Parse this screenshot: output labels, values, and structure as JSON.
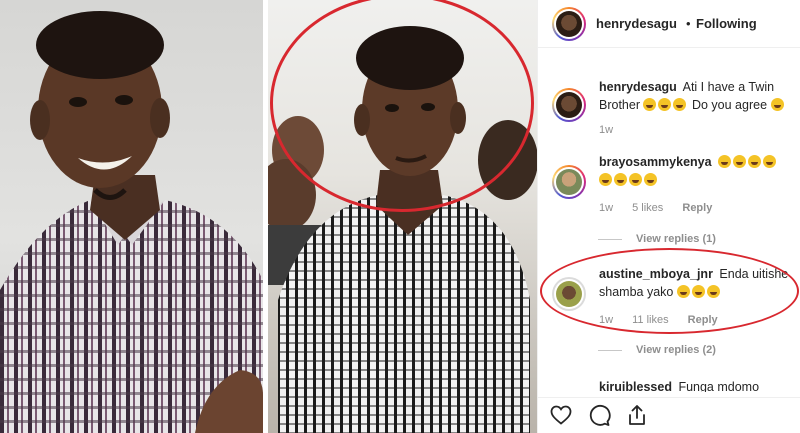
{
  "header": {
    "username": "henrydesagu",
    "separator": "•",
    "follow_status": "Following"
  },
  "comments": [
    {
      "username": "henrydesagu",
      "text_line1": "Ati I have a Twin",
      "text_line2_prefix": "Brother",
      "text_line2_suffix": "Do you agree",
      "time": "1w"
    },
    {
      "username": "brayosammykenya",
      "time": "1w",
      "likes": "5 likes",
      "reply_label": "Reply",
      "view_replies": "View replies (1)"
    },
    {
      "username": "austine_mboya_jnr",
      "text": "Enda uitishe shamba yako",
      "time": "1w",
      "likes": "11 likes",
      "reply_label": "Reply",
      "view_replies": "View replies (2)"
    },
    {
      "username": "kiruiblessed",
      "text": "Funga mdomo"
    }
  ],
  "icons": {
    "like": "heart-icon",
    "comment": "comment-icon",
    "share": "share-icon"
  },
  "colors": {
    "annotation_red": "#d8282f",
    "meta_gray": "#8e8e8e",
    "text": "#262626"
  }
}
